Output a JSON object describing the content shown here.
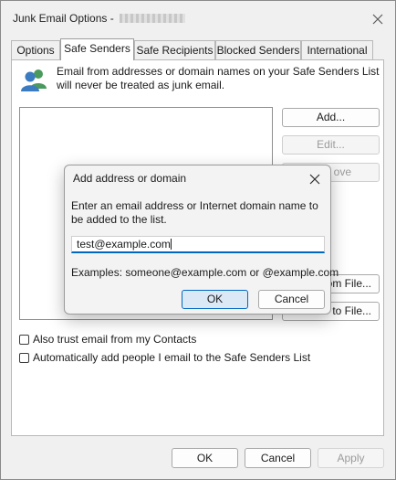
{
  "window": {
    "title": "Junk Email Options -"
  },
  "tabs": [
    {
      "label": "Options"
    },
    {
      "label": "Safe Senders"
    },
    {
      "label": "Safe Recipients"
    },
    {
      "label": "Blocked Senders"
    },
    {
      "label": "International"
    }
  ],
  "active_tab": "Safe Senders",
  "panel": {
    "description": "Email from addresses or domain names on your Safe Senders List will never be treated as junk email.",
    "list_items": [],
    "buttons": {
      "add": "Add...",
      "edit": "Edit...",
      "remove": "ove",
      "import": "om File...",
      "export": "to File..."
    },
    "checkboxes": [
      {
        "label": "Also trust email from my Contacts",
        "checked": false
      },
      {
        "label": "Automatically add people I email to the Safe Senders List",
        "checked": false
      }
    ]
  },
  "footer": {
    "ok": "OK",
    "cancel": "Cancel",
    "apply": "Apply"
  },
  "dialog": {
    "title": "Add address or domain",
    "prompt": "Enter an email address or Internet domain name to be added to the list.",
    "input_value": "test@example.com",
    "examples": "Examples: someone@example.com or @example.com",
    "ok": "OK",
    "cancel": "Cancel"
  },
  "icons": {
    "close": "close-icon",
    "people": "people-icon"
  },
  "colors": {
    "accent": "#0067c0",
    "people_blue": "#3b7bbf",
    "people_green": "#4a9a5d"
  }
}
